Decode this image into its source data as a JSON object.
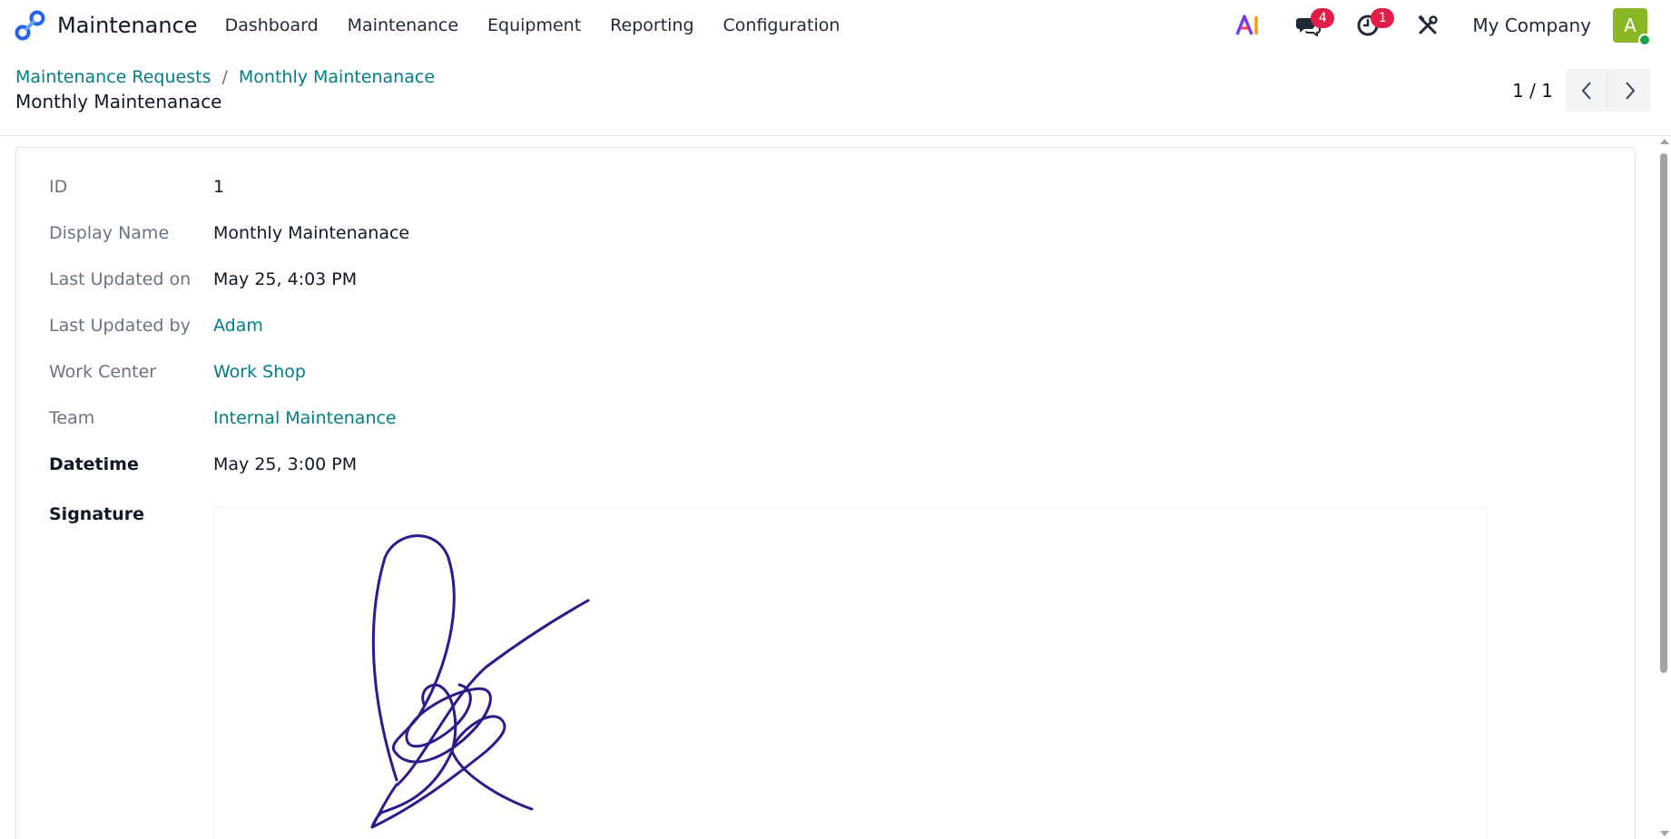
{
  "app": {
    "name": "Maintenance",
    "logo_icon": "maintenance-logo-icon"
  },
  "menu": {
    "items": [
      {
        "label": "Dashboard"
      },
      {
        "label": "Maintenance"
      },
      {
        "label": "Equipment"
      },
      {
        "label": "Reporting"
      },
      {
        "label": "Configuration"
      }
    ]
  },
  "systray": {
    "ai_icon": "ai-icon",
    "messages_icon": "chat-icon",
    "messages_count": "4",
    "activities_icon": "clock-icon",
    "activities_count": "1",
    "debug_icon": "tools-icon",
    "company": "My Company",
    "avatar_initial": "A",
    "badge_color": "#e11d48",
    "avatar_color": "#8bb624"
  },
  "breadcrumb": {
    "items": [
      {
        "label": "Maintenance Requests"
      },
      {
        "label": "Monthly Maintenanace"
      }
    ],
    "separator": "/",
    "current": "Monthly Maintenanace"
  },
  "pager": {
    "value": "1 / 1",
    "prev_icon": "chevron-left-icon",
    "next_icon": "chevron-right-icon"
  },
  "fields": [
    {
      "label": "ID",
      "value": "1"
    },
    {
      "label": "Display Name",
      "value": "Monthly Maintenanace"
    },
    {
      "label": "Last Updated on",
      "value": "May 25, 4:03 PM"
    },
    {
      "label": "Last Updated by",
      "value": "Adam"
    },
    {
      "label": "Work Center",
      "value": "Work Shop"
    },
    {
      "label": "Team",
      "value": "Internal Maintenance"
    },
    {
      "label": "Datetime",
      "value": "May 25, 3:00 PM"
    },
    {
      "label": "Signature"
    }
  ],
  "colors": {
    "accent": "#017e84",
    "signature_ink": "#2e1a8a"
  }
}
